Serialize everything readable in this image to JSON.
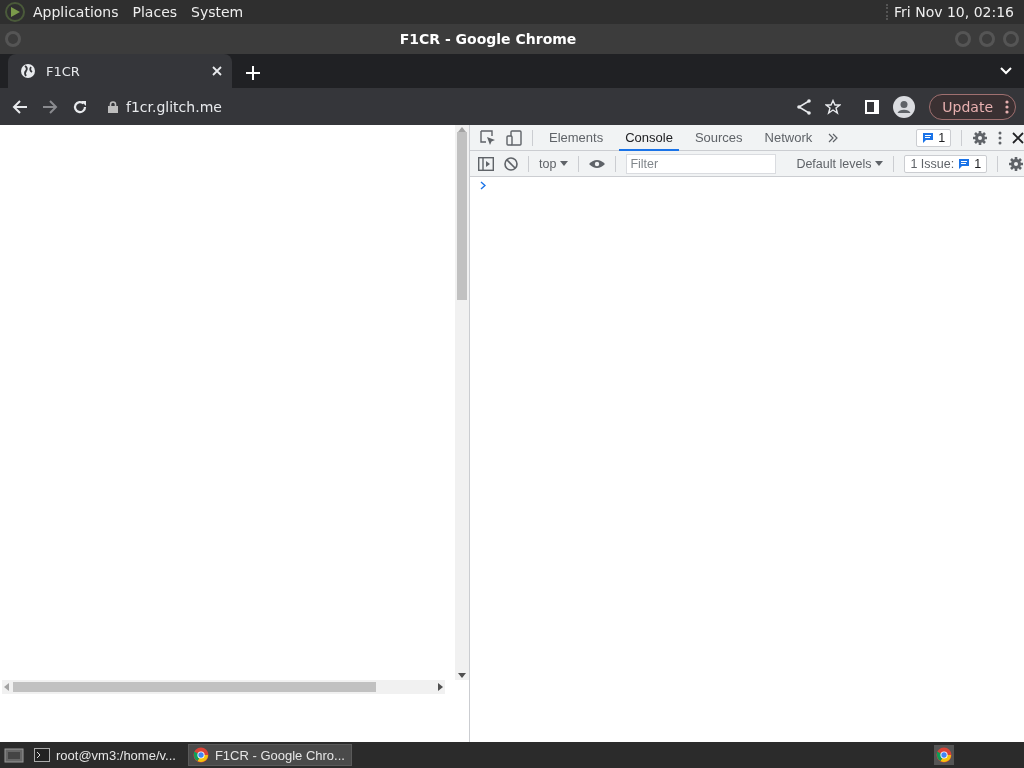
{
  "top_panel": {
    "menus": [
      "Applications",
      "Places",
      "System"
    ],
    "clock": "Fri Nov 10, 02:16"
  },
  "window": {
    "title": "F1CR - Google Chrome"
  },
  "tabs": [
    {
      "label": "F1CR",
      "selected": true
    }
  ],
  "toolbar": {
    "url": "f1cr.glitch.me",
    "update_button": "Update"
  },
  "devtools": {
    "tabs": [
      {
        "label": "Elements",
        "selected": false
      },
      {
        "label": "Console",
        "selected": true
      },
      {
        "label": "Sources",
        "selected": false
      },
      {
        "label": "Network",
        "selected": false
      }
    ],
    "messages_badge": "1",
    "context": "top",
    "filter_placeholder": "Filter",
    "levels": "Default levels",
    "issues_label": "1 Issue:",
    "issues_count": "1"
  },
  "taskbar": {
    "items": [
      {
        "kind": "terminal",
        "label": "root@vm3:/home/v...",
        "selected": false
      },
      {
        "kind": "chrome",
        "label": "F1CR - Google Chro...",
        "selected": true
      }
    ]
  }
}
